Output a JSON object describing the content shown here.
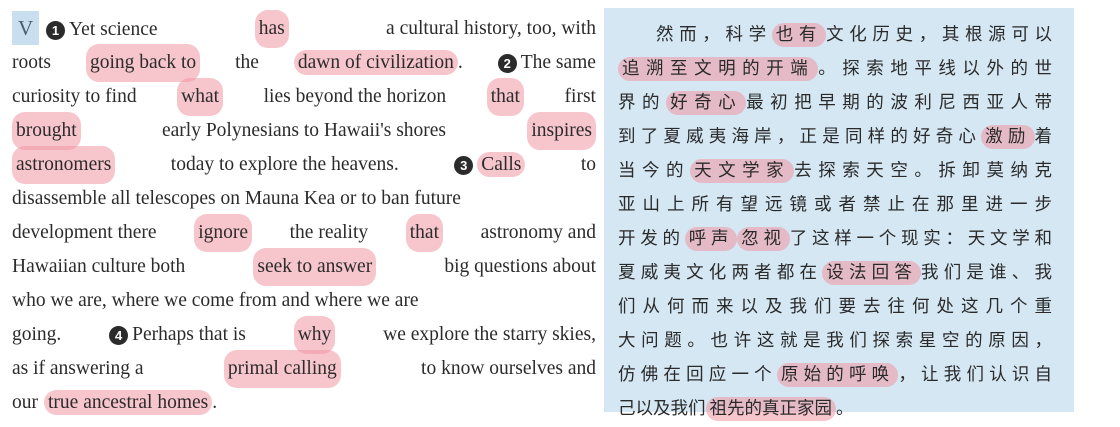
{
  "english": {
    "section_mark": "V",
    "markers": [
      "1",
      "2",
      "3",
      "4"
    ],
    "lines": [
      [
        "",
        "Yet science",
        "has",
        "a cultural history, too, with"
      ],
      [
        "roots",
        "going back to",
        "the",
        "dawn of civilization",
        ".",
        "The same"
      ],
      [
        "curiosity to find",
        "what",
        "lies beyond the horizon",
        "that",
        "first"
      ],
      [
        "brought",
        "early Polynesians to Hawaii's shores",
        "inspires"
      ],
      [
        "astronomers",
        "today to explore the heavens.",
        "",
        "Calls",
        "to"
      ],
      [
        "disassemble all telescopes on Mauna Kea or to ban future"
      ],
      [
        "development there",
        "ignore",
        "the reality",
        "that",
        "astronomy and"
      ],
      [
        "Hawaiian culture both",
        "seek to answer",
        "big questions about"
      ],
      [
        "who we are, where we come from and where we are"
      ],
      [
        "going.",
        "Perhaps that is",
        "why",
        "we explore the starry skies,"
      ],
      [
        "as if answering a",
        "primal calling",
        "to know ourselves and"
      ],
      [
        "our",
        "true ancestral homes",
        "."
      ]
    ]
  },
  "chinese": {
    "lines": [
      [
        "然而，科学",
        "也有",
        "文化历史，其根源可以"
      ],
      [
        "追溯至文明的开端",
        "。探索地平线以外的世"
      ],
      [
        "界的",
        "好奇心",
        "最初把早期的波利尼西亚人带"
      ],
      [
        "到了夏威夷海岸，正是同样的好奇心",
        "激励",
        "着"
      ],
      [
        "当今的",
        "天文学家",
        "去探索天空。拆卸莫纳克"
      ],
      [
        "亚山上所有望远镜或者禁止在那里进一步"
      ],
      [
        "开发的",
        "呼声",
        "忽视",
        "了这样一个现实：天文学和"
      ],
      [
        "夏威夷文化两者都在",
        "设法回答",
        "我们是谁、我"
      ],
      [
        "们从何而来以及我们要去往何处这几个重"
      ],
      [
        "大问题。也许这就是我们探索星空的原因，"
      ],
      [
        "仿佛在回应一个",
        "原始的呼唤",
        "，让我们认识自"
      ],
      [
        "己以及我们",
        "祖先的真正家园",
        "。"
      ]
    ]
  }
}
